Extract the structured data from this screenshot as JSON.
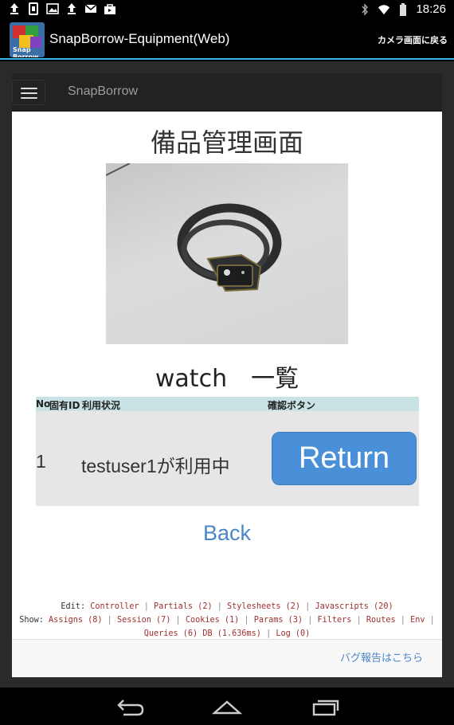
{
  "status_bar": {
    "time": "18:26",
    "left_icons": [
      "upload-icon",
      "sim-icon",
      "image-icon",
      "upload-icon",
      "gmail-icon",
      "bag-icon"
    ],
    "right_icons": [
      "bluetooth-icon",
      "wifi-icon",
      "battery-icon"
    ]
  },
  "action_bar": {
    "title": "SnapBorrow-Equipment(Web)",
    "camera_button": "カメラ画面に戻る",
    "icon_text": "Snap Borrow"
  },
  "navbar": {
    "brand": "SnapBorrow"
  },
  "page": {
    "heading": "備品管理画面",
    "section_heading": "watch　一覧",
    "table": {
      "headers": [
        "No",
        "固有ID",
        "利用状況",
        "確認ボタン"
      ],
      "rows": [
        {
          "no": "1",
          "id": "",
          "status": "testuser1が利用中",
          "button": "Return"
        }
      ]
    },
    "back_link": "Back"
  },
  "debug": {
    "edit_label": "Edit:",
    "edit_links": [
      "Controller",
      "Partials (2)",
      "Stylesheets (2)",
      "Javascripts (20)"
    ],
    "show_label": "Show:",
    "show_links": [
      "Assigns (8)",
      "Session (7)",
      "Cookies (1)",
      "Params (3)",
      "Filters",
      "Routes",
      "Env",
      "Queries (6) DB (1.636ms)",
      "Log (0)"
    ]
  },
  "footer": {
    "bug_report": "バグ報告はこちら"
  },
  "nav_bar": {
    "buttons": [
      "back-icon",
      "home-icon",
      "recents-icon"
    ]
  }
}
